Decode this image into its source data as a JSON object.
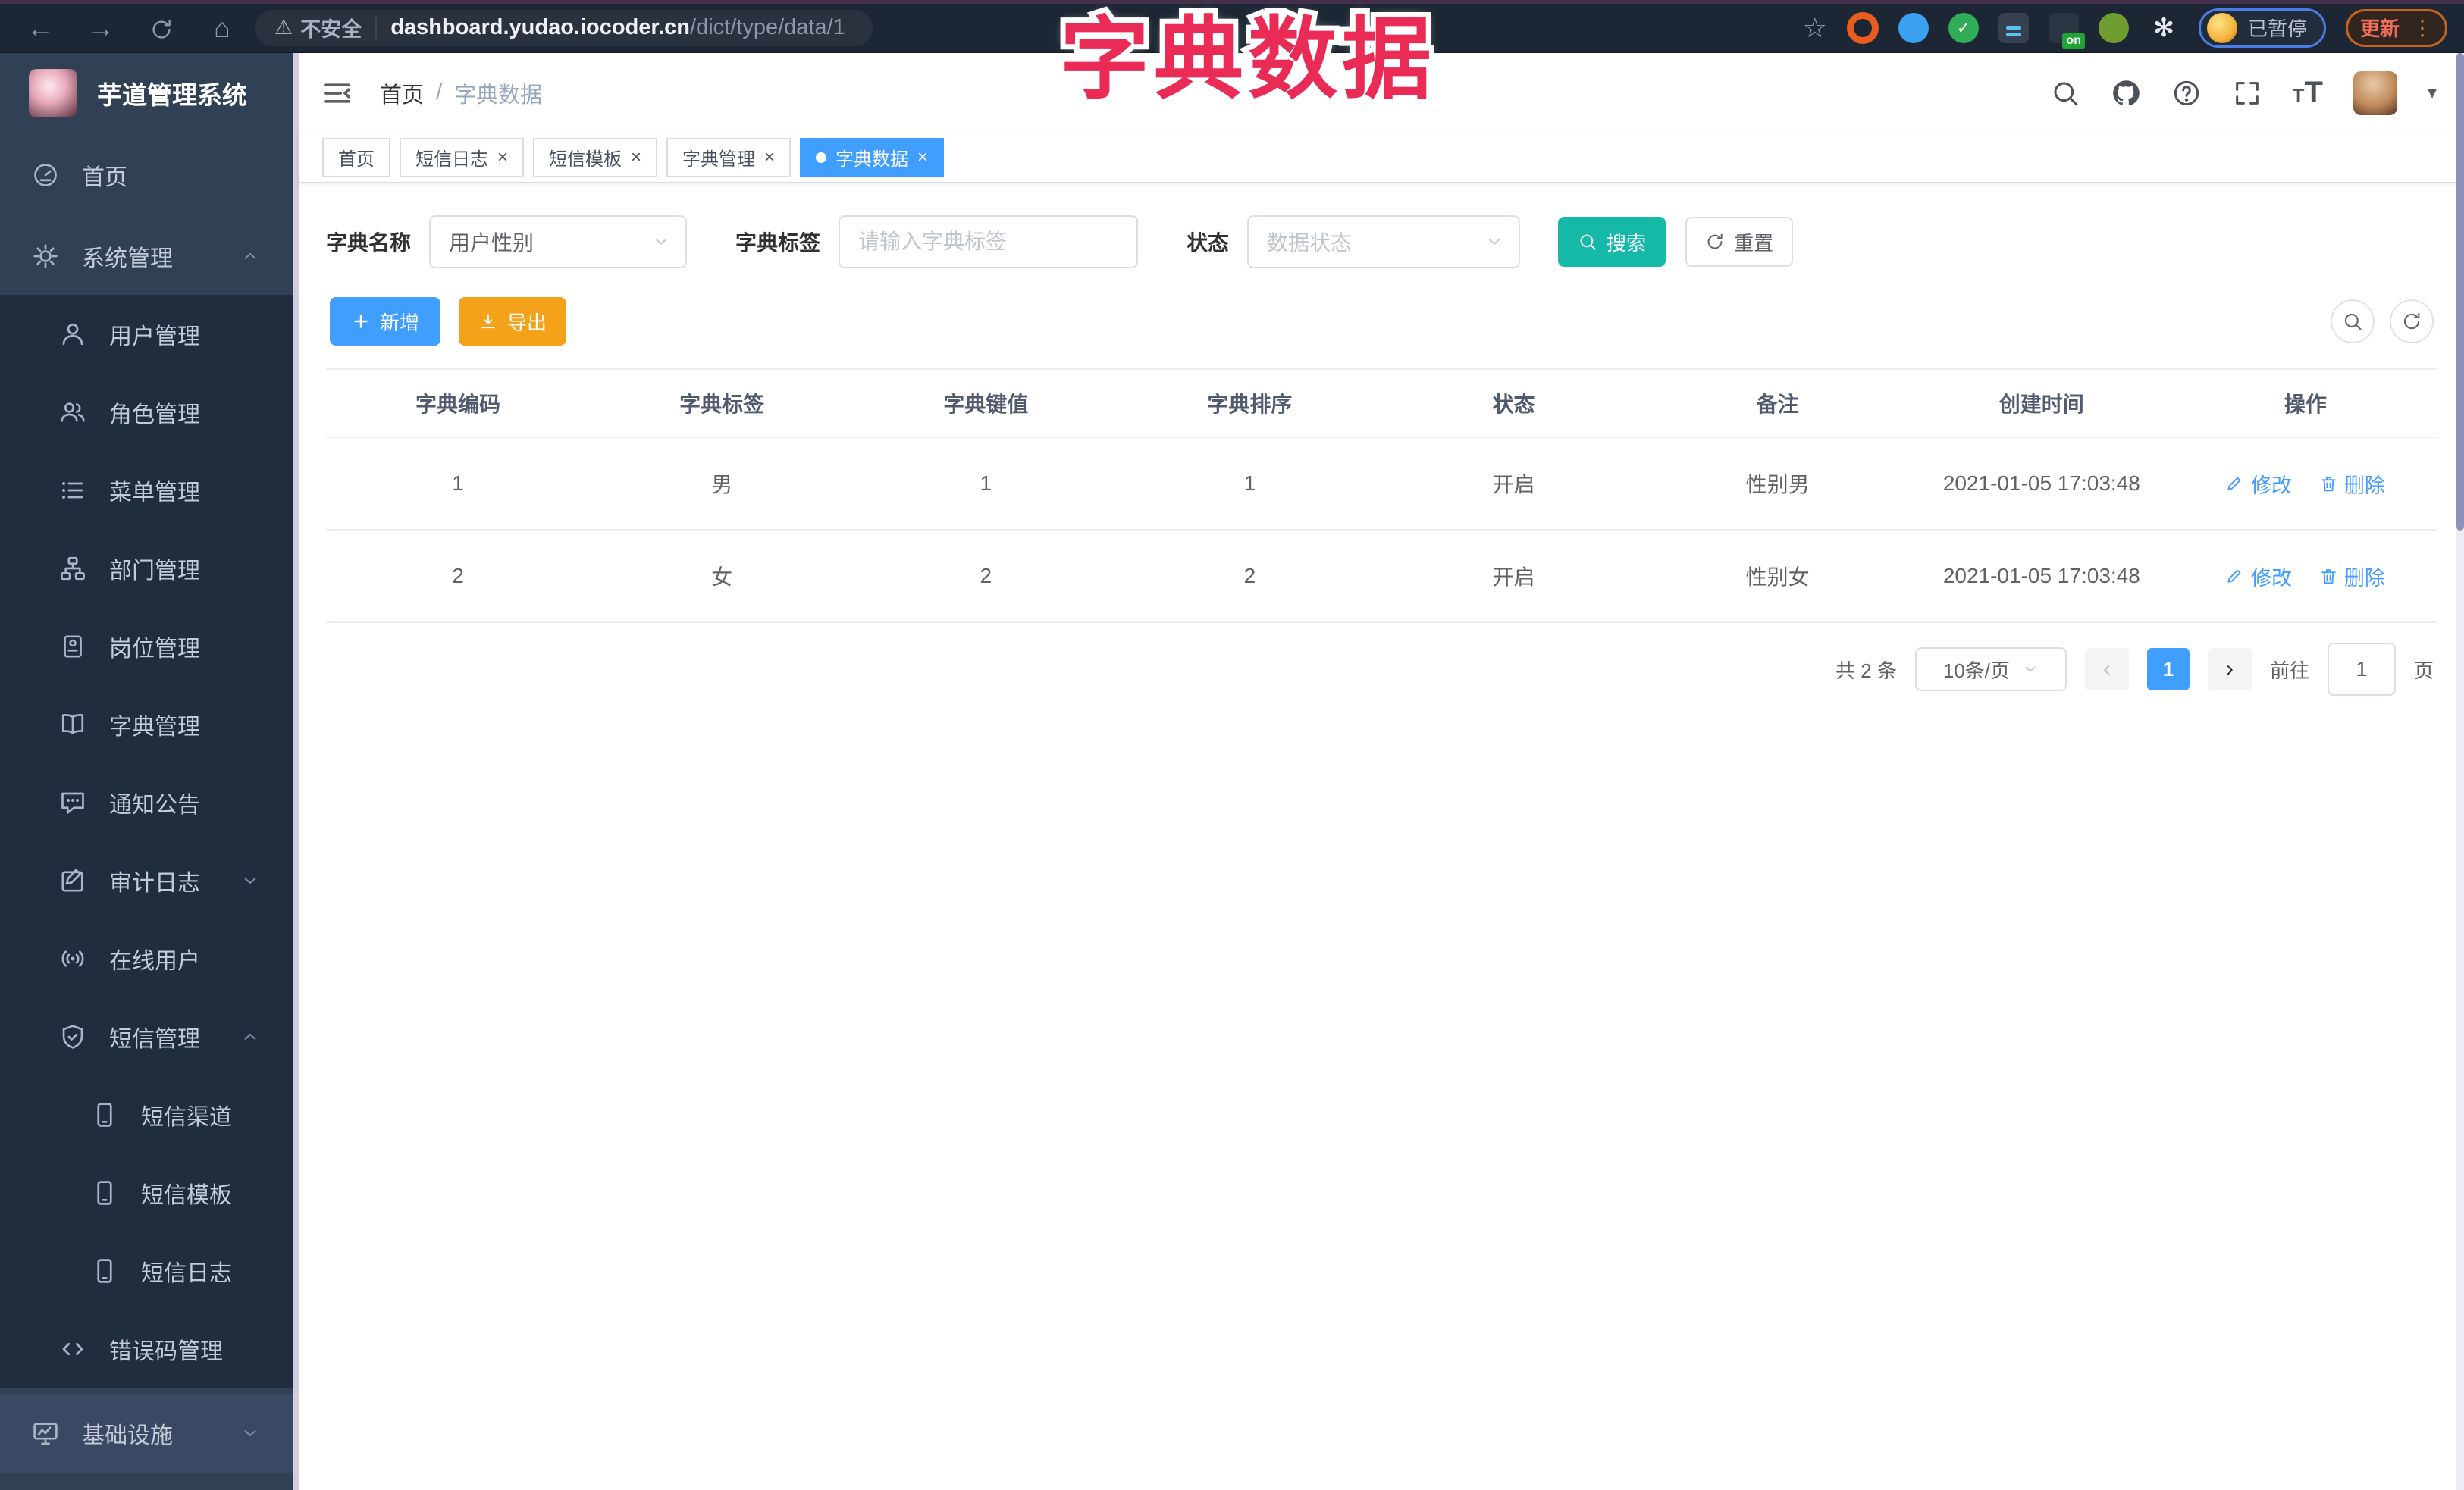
{
  "browser": {
    "security_label": "不安全",
    "url_host": "dashboard.yudao.iocoder.cn",
    "url_path": "/dict/type/data/1",
    "profile_status": "已暂停",
    "update_label": "更新",
    "ext_on_badge": "on"
  },
  "overlay_title": "字典数据",
  "sidebar": {
    "app_title": "芋道管理系统",
    "items": [
      {
        "label": "首页"
      },
      {
        "label": "系统管理"
      },
      {
        "label": "用户管理"
      },
      {
        "label": "角色管理"
      },
      {
        "label": "菜单管理"
      },
      {
        "label": "部门管理"
      },
      {
        "label": "岗位管理"
      },
      {
        "label": "字典管理"
      },
      {
        "label": "通知公告"
      },
      {
        "label": "审计日志"
      },
      {
        "label": "在线用户"
      },
      {
        "label": "短信管理"
      },
      {
        "label": "短信渠道"
      },
      {
        "label": "短信模板"
      },
      {
        "label": "短信日志"
      },
      {
        "label": "错误码管理"
      },
      {
        "label": "基础设施"
      }
    ]
  },
  "breadcrumb": {
    "home": "首页",
    "current": "字典数据"
  },
  "tabs": [
    {
      "label": "首页"
    },
    {
      "label": "短信日志"
    },
    {
      "label": "短信模板"
    },
    {
      "label": "字典管理"
    },
    {
      "label": "字典数据"
    }
  ],
  "filters": {
    "dict_name_label": "字典名称",
    "dict_name_value": "用户性别",
    "dict_label_label": "字典标签",
    "dict_label_placeholder": "请输入字典标签",
    "status_label": "状态",
    "status_placeholder": "数据状态",
    "search_label": "搜索",
    "reset_label": "重置"
  },
  "toolbar": {
    "add_label": "新增",
    "export_label": "导出"
  },
  "table": {
    "headers": [
      "字典编码",
      "字典标签",
      "字典键值",
      "字典排序",
      "状态",
      "备注",
      "创建时间",
      "操作"
    ],
    "rows": [
      {
        "code": "1",
        "label": "男",
        "value": "1",
        "sort": "1",
        "status": "开启",
        "remark": "性别男",
        "created": "2021-01-05 17:03:48"
      },
      {
        "code": "2",
        "label": "女",
        "value": "2",
        "sort": "2",
        "status": "开启",
        "remark": "性别女",
        "created": "2021-01-05 17:03:48"
      }
    ],
    "edit_label": "修改",
    "delete_label": "删除"
  },
  "pagination": {
    "total": "共 2 条",
    "page_size": "10条/页",
    "page": "1",
    "goto_label": "前往",
    "goto_value": "1",
    "unit_label": "页"
  },
  "glyphs": {
    "back": "←",
    "forward": "→",
    "home": "⌂",
    "star": "☆",
    "warning": "⚠",
    "dots": "⋮",
    "caret": "▾",
    "close": "×",
    "prev": "‹",
    "next": "›",
    "sep": "/",
    "check": "✓",
    "puzzle": "✻",
    "t_small": "T",
    "t_big": "T"
  },
  "colors": {
    "primary_blue": "#409eff",
    "search_teal": "#16b8a8",
    "export_orange": "#f3a21a",
    "title_pink": "#ea2b55",
    "sidebar_bg": "#304156",
    "submenu_bg": "#1f2d3d"
  }
}
